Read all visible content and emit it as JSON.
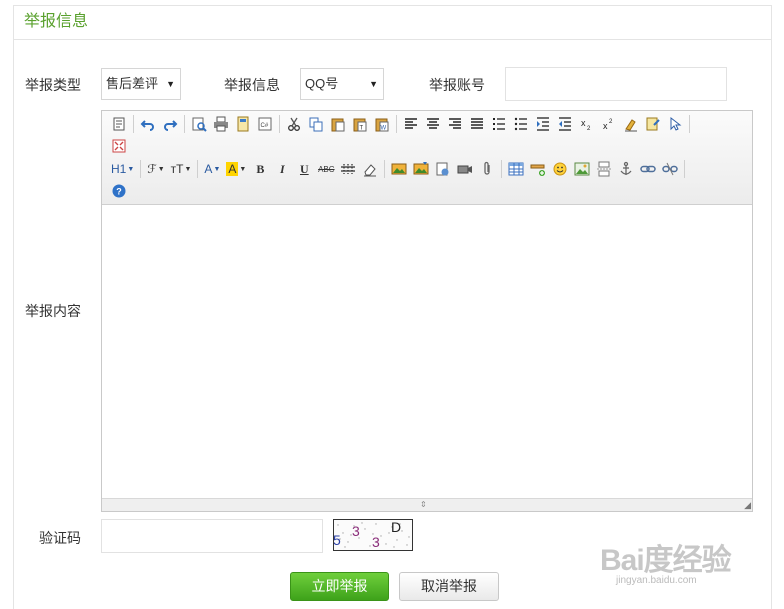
{
  "panel": {
    "title": "举报信息"
  },
  "form": {
    "type_label": "举报类型",
    "type_value": "售后差评",
    "info_label": "举报信息",
    "info_value": "QQ号",
    "account_label": "举报账号",
    "account_value": "",
    "content_label": "举报内容",
    "captcha_label": "验证码",
    "captcha_value": "",
    "captcha_chars": [
      "5",
      "3",
      "3",
      "D"
    ]
  },
  "toolbar": {
    "heading_label": "H1",
    "font_label": "ℱ",
    "size_label": "тT",
    "font_color_label": "A",
    "bg_color_label": "A",
    "bold": "B",
    "italic": "I",
    "underline": "U",
    "strike": "ABC"
  },
  "buttons": {
    "submit": "立即举报",
    "cancel": "取消举报"
  },
  "watermark": {
    "main": "Bai度经验",
    "sub": "jingyan.baidu.com"
  },
  "colors": {
    "title_green": "#5aa12e",
    "submit_green": "#4cb626"
  }
}
